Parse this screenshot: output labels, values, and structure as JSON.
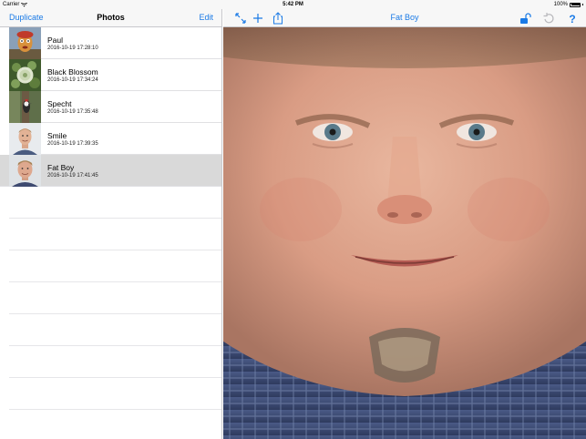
{
  "status": {
    "carrier": "Carrier",
    "time": "5:42 PM",
    "battery": "100%"
  },
  "master": {
    "left_button": "Duplicate",
    "title": "Photos",
    "right_button": "Edit",
    "items": [
      {
        "name": "Paul",
        "date": "2016-10-19 17:28:10"
      },
      {
        "name": "Black Blossom",
        "date": "2016-10-19 17:34:24"
      },
      {
        "name": "Specht",
        "date": "2016-10-19 17:35:48"
      },
      {
        "name": "Smile",
        "date": "2016-10-19 17:39:35"
      },
      {
        "name": "Fat Boy",
        "date": "2016-10-19 17:41:45"
      }
    ]
  },
  "detail": {
    "title": "Fat Boy",
    "icons": [
      "expand-icon",
      "add-icon",
      "share-icon",
      "lock-icon",
      "undo-icon",
      "help-icon"
    ]
  },
  "colors": {
    "accent": "#1a7ae6",
    "selected_row": "#d9d9d9"
  }
}
